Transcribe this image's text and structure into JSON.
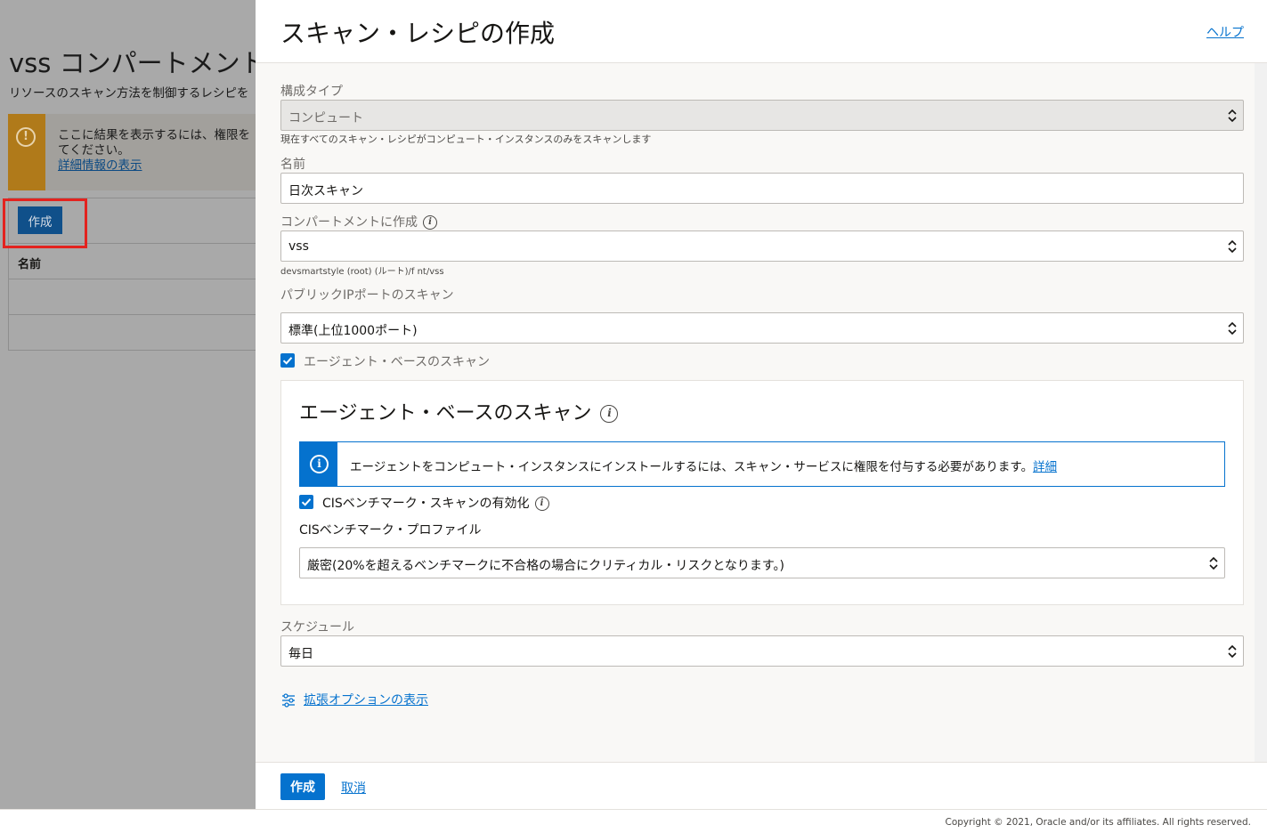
{
  "background": {
    "title_prefix": "vss",
    "title_rest": "コンパートメント",
    "description": "リソースのスキャン方法を制御するレシピを",
    "alert_line1": "ここに結果を表示するには、権限を",
    "alert_line2": "てください。",
    "alert_link": "詳細情報の表示",
    "create_button": "作成",
    "table_header_name": "名前"
  },
  "drawer": {
    "title": "スキャン・レシピの作成",
    "help_link": "ヘルプ",
    "config_type": {
      "label": "構成タイプ",
      "value": "コンピュート",
      "hint": "現在すべてのスキャン・レシピがコンピュート・インスタンスのみをスキャンします"
    },
    "name": {
      "label": "名前",
      "value": "日次スキャン"
    },
    "compartment": {
      "label": "コンパートメントに作成",
      "value": "vss",
      "path": "devsmartstyle (root) (ルート)/f        nt/vss"
    },
    "public_ip_scan": {
      "label": "パブリックIPポートのスキャン",
      "value": "標準(上位1000ポート)"
    },
    "agent_checkbox_label": "エージェント・ベースのスキャン",
    "agent_section": {
      "title": "エージェント・ベースのスキャン",
      "notice_text": "エージェントをコンピュート・インスタンスにインストールするには、スキャン・サービスに権限を付与する必要があります。",
      "notice_link": "詳細",
      "cis_checkbox_label": "CISベンチマーク・スキャンの有効化",
      "cis_profile_label": "CISベンチマーク・プロファイル",
      "cis_profile_value": "厳密(20%を超えるベンチマークに不合格の場合にクリティカル・リスクとなります。)"
    },
    "schedule": {
      "label": "スケジュール",
      "value": "毎日"
    },
    "advanced_link": "拡張オプションの表示",
    "footer": {
      "create_button": "作成",
      "cancel_link": "取消"
    }
  },
  "page_footer": {
    "copyright": "Copyright © 2021, Oracle and/or its affiliates. All rights reserved."
  },
  "colors": {
    "accent": "#0572ce",
    "highlight": "#e3231f",
    "warning": "#b07a1a"
  }
}
